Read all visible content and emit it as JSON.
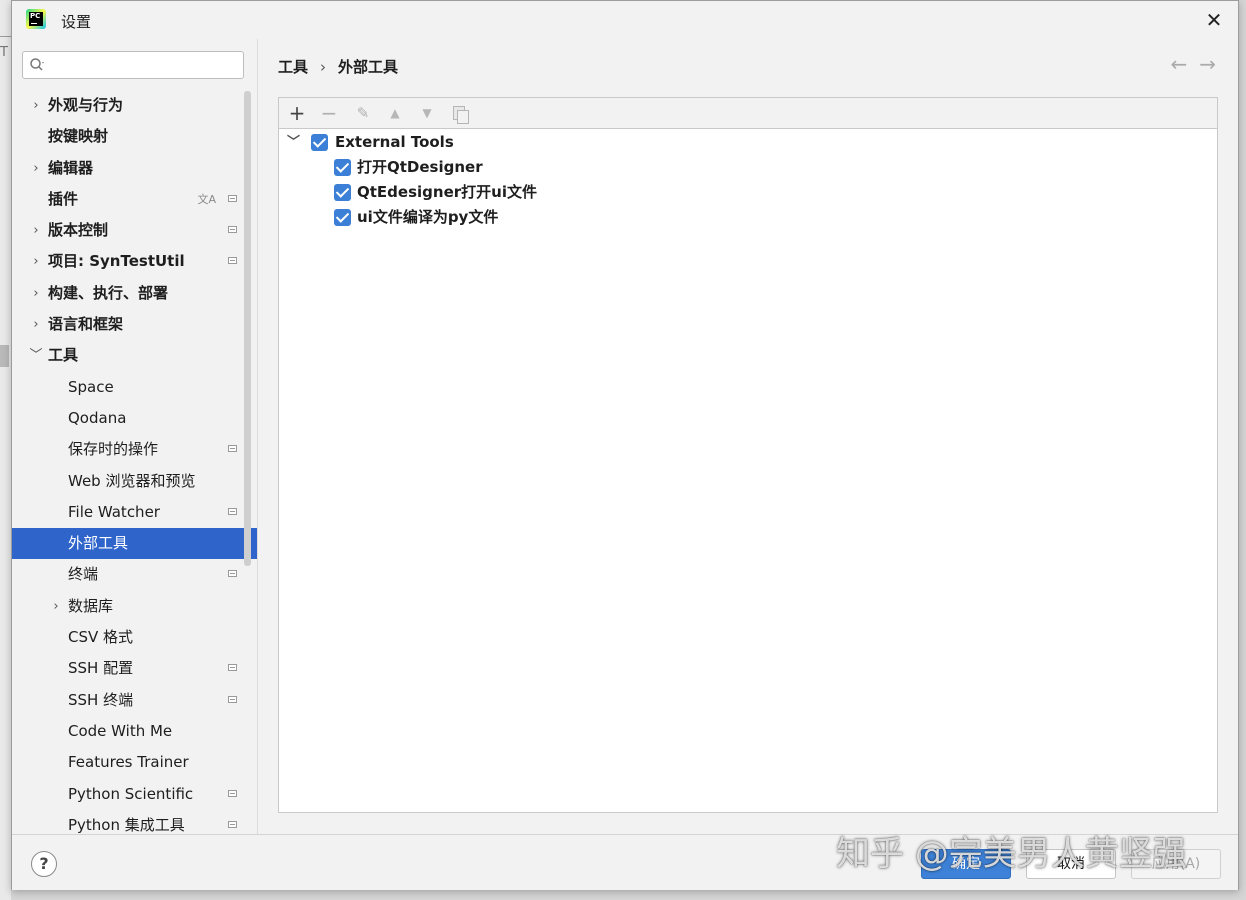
{
  "window": {
    "title": "设置",
    "close_label": "✕"
  },
  "background": {
    "left_letter": "T"
  },
  "search": {
    "placeholder": ""
  },
  "sidebar": {
    "items": [
      {
        "label": "外观与行为",
        "level": 1,
        "expandable": true,
        "expanded": false
      },
      {
        "label": "按键映射",
        "level": 1,
        "expandable": false
      },
      {
        "label": "编辑器",
        "level": 1,
        "expandable": true,
        "expanded": false
      },
      {
        "label": "插件",
        "level": 1,
        "expandable": false,
        "translate_icon": true,
        "project_icon": true
      },
      {
        "label": "版本控制",
        "level": 1,
        "expandable": true,
        "expanded": false,
        "project_icon": true
      },
      {
        "label": "项目: SynTestUtil",
        "level": 1,
        "expandable": true,
        "expanded": false,
        "project_icon": true
      },
      {
        "label": "构建、执行、部署",
        "level": 1,
        "expandable": true,
        "expanded": false
      },
      {
        "label": "语言和框架",
        "level": 1,
        "expandable": true,
        "expanded": false
      },
      {
        "label": "工具",
        "level": 1,
        "expandable": true,
        "expanded": true
      },
      {
        "label": "Space",
        "level": 2,
        "expandable": false
      },
      {
        "label": "Qodana",
        "level": 2,
        "expandable": false
      },
      {
        "label": "保存时的操作",
        "level": 2,
        "expandable": false,
        "project_icon": true
      },
      {
        "label": "Web 浏览器和预览",
        "level": 2,
        "expandable": false
      },
      {
        "label": "File Watcher",
        "level": 2,
        "expandable": false,
        "project_icon": true
      },
      {
        "label": "外部工具",
        "level": 2,
        "expandable": false,
        "selected": true
      },
      {
        "label": "终端",
        "level": 2,
        "expandable": false,
        "project_icon": true
      },
      {
        "label": "数据库",
        "level": 2,
        "expandable": true,
        "expanded": false
      },
      {
        "label": "CSV 格式",
        "level": 2,
        "expandable": false
      },
      {
        "label": "SSH 配置",
        "level": 2,
        "expandable": false,
        "project_icon": true
      },
      {
        "label": "SSH 终端",
        "level": 2,
        "expandable": false,
        "project_icon": true
      },
      {
        "label": "Code With Me",
        "level": 2,
        "expandable": false
      },
      {
        "label": "Features Trainer",
        "level": 2,
        "expandable": false
      },
      {
        "label": "Python Scientific",
        "level": 2,
        "expandable": false,
        "project_icon": true
      },
      {
        "label": "Python 集成工具",
        "level": 2,
        "expandable": false,
        "project_icon": true
      }
    ]
  },
  "breadcrumb": {
    "parent": "工具",
    "separator": "›",
    "current": "外部工具"
  },
  "nav_arrows": {
    "back": "←",
    "forward": "→"
  },
  "toolbar": {
    "add": "+",
    "remove": "−",
    "edit": "✎",
    "up": "▲",
    "down": "▼"
  },
  "tree": {
    "root": {
      "label": "External Tools",
      "checked": true,
      "expanded": true
    },
    "children": [
      {
        "label": "打开QtDesigner",
        "checked": true
      },
      {
        "label": "QtEdesigner打开ui文件",
        "checked": true
      },
      {
        "label": "ui文件编译为py文件",
        "checked": true
      }
    ]
  },
  "buttons": {
    "help": "?",
    "ok": "确定",
    "cancel": "取消",
    "apply": "应用(A)"
  },
  "watermark": "知乎 @完美男人黄竖强",
  "colors": {
    "selection": "#2f65ca",
    "checkbox": "#3c7fd6",
    "ok_button": "#3d82d8"
  }
}
